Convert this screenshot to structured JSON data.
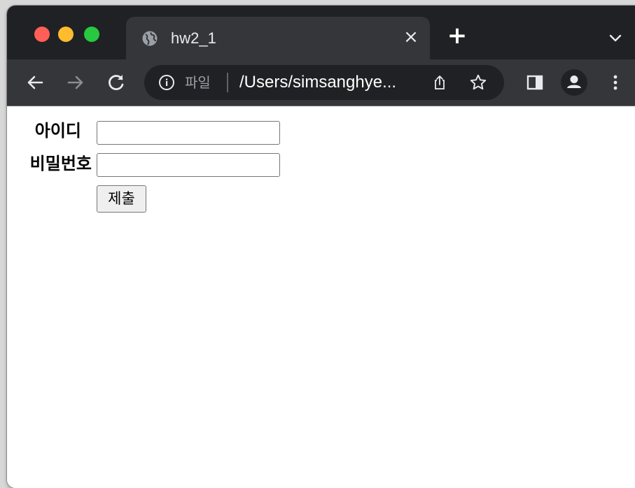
{
  "browser": {
    "tab": {
      "title": "hw2_1",
      "icon": "globe-icon",
      "close_glyph": "×"
    },
    "new_tab_glyph": "+",
    "address_bar": {
      "scheme_label": "파일",
      "url_display": "/Users/simsanghye..."
    },
    "colors": {
      "frame": "#202124",
      "toolbar": "#35363a",
      "traffic_red": "#ff5f57",
      "traffic_yellow": "#febc2e",
      "traffic_green": "#28c840"
    }
  },
  "page": {
    "form": {
      "id_label": "아이디",
      "password_label": "비밀번호",
      "id_value": "",
      "password_value": "",
      "submit_label": "제출"
    }
  }
}
